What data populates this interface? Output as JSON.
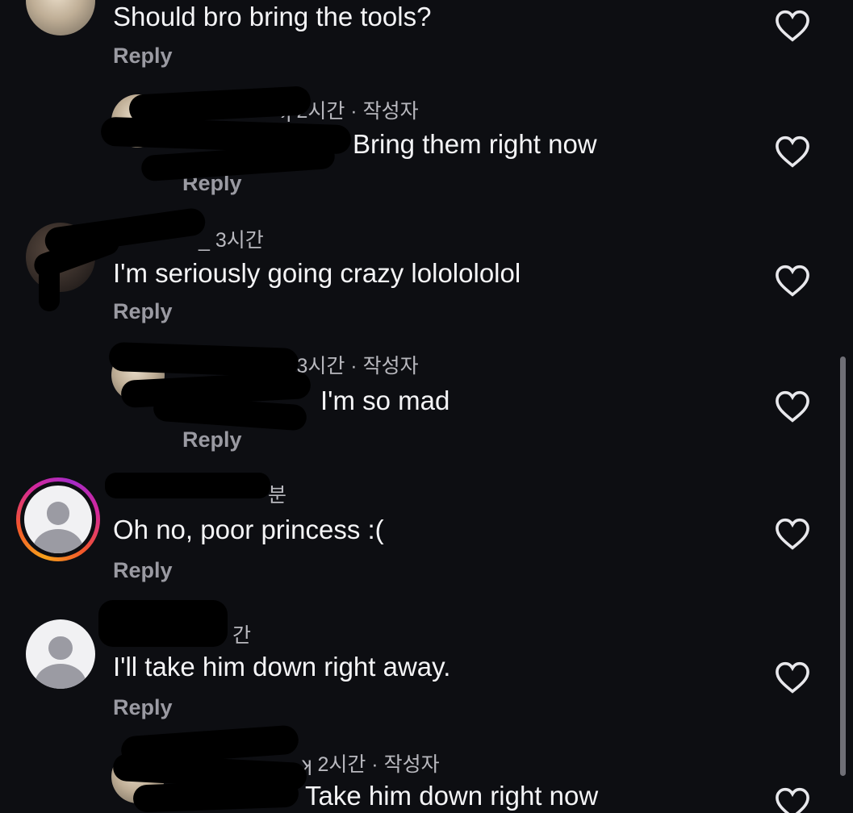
{
  "comments": [
    {
      "meta": "",
      "text": "Should bro bring the tools?",
      "reply_label": "Reply"
    },
    {
      "meta": "ʞ 2시간 · 작성자",
      "text": "Bring them right now",
      "reply_label": "Reply"
    },
    {
      "meta": "_ 3시간",
      "text": "I'm seriously going crazy lololololol",
      "reply_label": "Reply"
    },
    {
      "meta": "ʞ 3시간 · 작성자",
      "text": "I'm so mad",
      "reply_label": "Reply"
    },
    {
      "meta": "분",
      "text": "Oh no, poor princess :(",
      "reply_label": "Reply"
    },
    {
      "meta": "간",
      "text": "I'll take him down right away.",
      "reply_label": "Reply"
    },
    {
      "meta": "ʞ 2시간 · 작성자",
      "text": "Take him down right now",
      "reply_label": ""
    }
  ],
  "icons": {
    "like": "heart-outline-icon",
    "avatar_default": "default-user-icon"
  },
  "colors": {
    "background": "#0d0e12",
    "text": "#f4f4f6",
    "secondary": "#9a9aa2",
    "story_ring": [
      "#f7a21b",
      "#d5289a",
      "#a42bc7"
    ]
  }
}
